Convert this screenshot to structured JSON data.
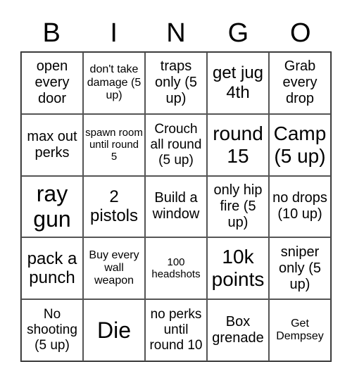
{
  "header": [
    "B",
    "I",
    "N",
    "G",
    "O"
  ],
  "cells": [
    "open every door",
    "don't take damage (5 up)",
    "traps only (5 up)",
    "get jug 4th",
    "Grab every drop",
    "max out perks",
    "spawn room until round 5",
    "Crouch all round (5 up)",
    "round 15",
    "Camp (5 up)",
    "ray gun",
    "2 pistols",
    "Build a window",
    "only hip fire (5 up)",
    "no drops (10 up)",
    "pack a punch",
    "Buy every wall weapon",
    "100 headshots",
    "10k points",
    "sniper only (5 up)",
    "No shooting (5 up)",
    "Die",
    "no perks until round 10",
    "Box grenade",
    "Get Dempsey"
  ]
}
